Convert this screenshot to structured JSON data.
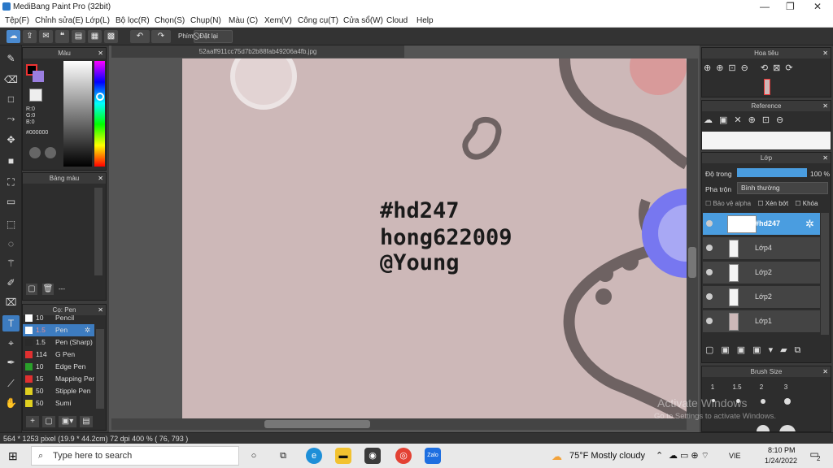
{
  "window": {
    "title": "MediBang Paint Pro (32bit)",
    "minimize": "—",
    "restore": "❐",
    "close": "✕"
  },
  "menu": [
    "Tệp(F)",
    "Chỉnh sửa(E)",
    "Lớp(L)",
    "Bộ lọc(R)",
    "Chọn(S)",
    "Chụp(N)",
    "Màu (C)",
    "Xem(V)",
    "Công cụ(T)",
    "Cửa sổ(W)",
    "Cloud",
    "Help"
  ],
  "toolbar": {
    "shortcut_label": "Phím",
    "reset_label": "Đặt lại"
  },
  "color_panel": {
    "title": "Màu",
    "r": "R:0",
    "g": "G:0",
    "b": "B:0",
    "hex": "#000000"
  },
  "palette_panel": {
    "title": "Bảng màu",
    "footer": "---"
  },
  "brush_panel": {
    "title": "Cọ: Pen",
    "items": [
      {
        "size": "10",
        "name": "Pencil",
        "color": "#ffffff"
      },
      {
        "size": "1.5",
        "name": "Pen",
        "color": "#ffffff",
        "selected": true
      },
      {
        "size": "1.5",
        "name": "Pen (Sharp)",
        "color": "#2a2a2a"
      },
      {
        "size": "114",
        "name": "G Pen",
        "color": "#e03030"
      },
      {
        "size": "10",
        "name": "Edge Pen",
        "color": "#2aa02a"
      },
      {
        "size": "15",
        "name": "Mapping Pen",
        "color": "#e03030"
      },
      {
        "size": "50",
        "name": "Stipple Pen",
        "color": "#e0d020"
      },
      {
        "size": "50",
        "name": "Sumi",
        "color": "#e0d020"
      }
    ]
  },
  "document": {
    "tab_title": "52aaff911cc75d7b2b88fab49206a4fb.jpg",
    "text_lines": [
      "#hd247",
      "hong622009",
      "@Young"
    ]
  },
  "navigator": {
    "title": "Hoa tiêu"
  },
  "reference": {
    "title": "Reference"
  },
  "layer_panel": {
    "title": "Lớp",
    "opacity_label": "Độ trong",
    "opacity_value": "100 %",
    "opacity": 1.0,
    "blend_label": "Pha trộn",
    "blend_value": "Bình thường",
    "protect_alpha": "Bảo vệ alpha",
    "clipping": "Xén bớt",
    "lock": "Khóa",
    "layers": [
      "#hd247",
      "Lớp4",
      "Lớp2",
      "Lớp2",
      "Lớp1"
    ]
  },
  "brush_size_panel": {
    "title": "Brush Size",
    "sizes": [
      "1",
      "1.5",
      "2",
      "3"
    ]
  },
  "watermark": {
    "line1": "Activate Windows",
    "line2": "Go to Settings to activate Windows."
  },
  "status": {
    "size": "564 * 1253 pixel",
    "cm": "(19.9 * 44.2cm)",
    "dpi": "72 dpi",
    "zoom": "400 %",
    "coords": "( 76, 793 )"
  },
  "taskbar": {
    "search_placeholder": "Type here to search",
    "weather": "75°F  Mostly cloudy",
    "lang": "VIE",
    "time": "8:10 PM",
    "date": "1/24/2022",
    "notifications": "2",
    "zalo": "Zalo"
  }
}
